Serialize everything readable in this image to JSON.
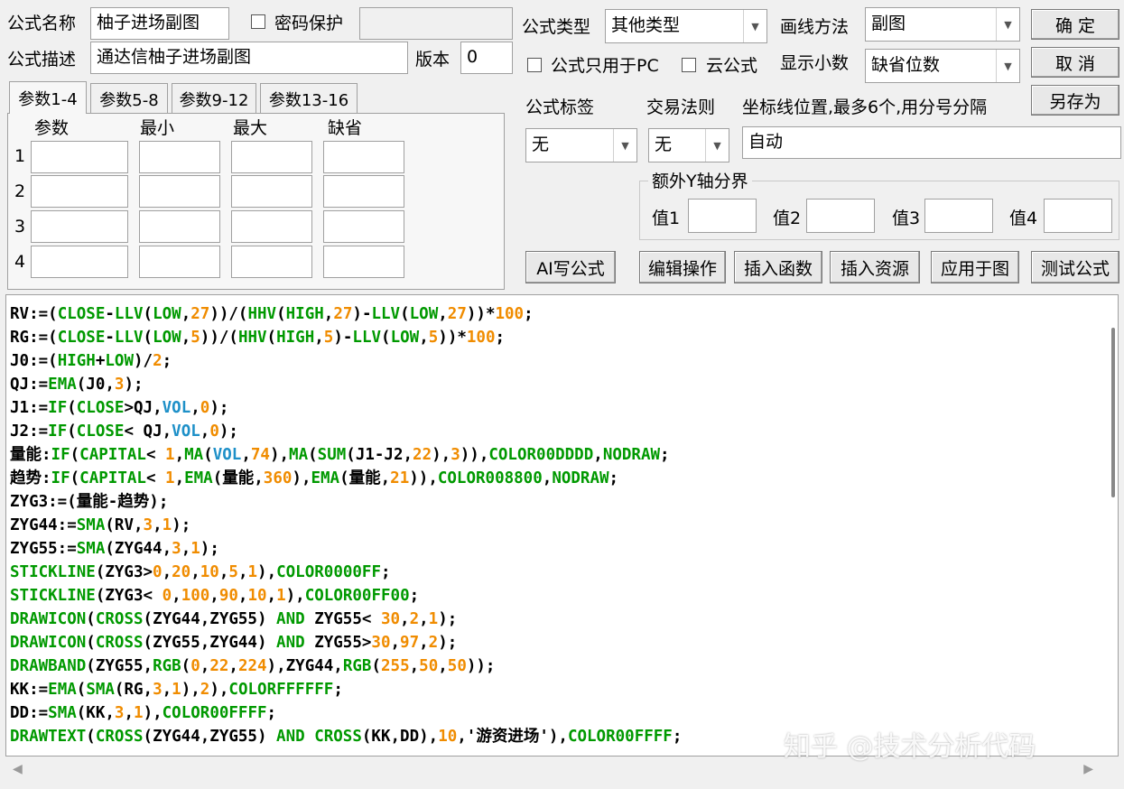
{
  "form": {
    "name_label": "公式名称",
    "name_value": "柚子进场副图",
    "password_label": "密码保护",
    "desc_label": "公式描述",
    "desc_value": "通达信柚子进场副图",
    "version_label": "版本",
    "version_value": "0",
    "type_label": "公式类型",
    "type_value": "其他类型",
    "draw_label": "画线方法",
    "draw_value": "副图",
    "pc_only_label": "公式只用于PC",
    "cloud_label": "云公式",
    "decimal_label": "显示小数",
    "decimal_value": "缺省位数",
    "tag_label": "公式标签",
    "tag_value": "无",
    "rule_label": "交易法则",
    "rule_value": "无",
    "axis_label": "坐标线位置,最多6个,用分号分隔",
    "axis_value": "自动",
    "extra_y_label": "额外Y轴分界",
    "v1": "值1",
    "v2": "值2",
    "v3": "值3",
    "v4": "值4"
  },
  "buttons": {
    "ok": "确  定",
    "cancel": "取  消",
    "save_as": "另存为",
    "ai": "AI写公式",
    "edit": "编辑操作",
    "insert_func": "插入函数",
    "insert_res": "插入资源",
    "apply": "应用于图",
    "test": "测试公式"
  },
  "tabs": [
    "参数1-4",
    "参数5-8",
    "参数9-12",
    "参数13-16"
  ],
  "params": {
    "headers": [
      "参数",
      "最小",
      "最大",
      "缺省"
    ],
    "rows": [
      "1",
      "2",
      "3",
      "4"
    ]
  },
  "code_lines": [
    [
      [
        "RV:=(",
        "b"
      ],
      [
        "CLOSE",
        "g"
      ],
      [
        "-",
        "b"
      ],
      [
        "LLV",
        "g"
      ],
      [
        "(",
        "b"
      ],
      [
        "LOW",
        "g"
      ],
      [
        ",",
        "b"
      ],
      [
        "27",
        "o"
      ],
      [
        "))/(",
        "b"
      ],
      [
        "HHV",
        "g"
      ],
      [
        "(",
        "b"
      ],
      [
        "HIGH",
        "g"
      ],
      [
        ",",
        "b"
      ],
      [
        "27",
        "o"
      ],
      [
        ")-",
        "b"
      ],
      [
        "LLV",
        "g"
      ],
      [
        "(",
        "b"
      ],
      [
        "LOW",
        "g"
      ],
      [
        ",",
        "b"
      ],
      [
        "27",
        "o"
      ],
      [
        "))*",
        "b"
      ],
      [
        "100",
        "o"
      ],
      [
        ";",
        "b"
      ]
    ],
    [
      [
        "RG:=(",
        "b"
      ],
      [
        "CLOSE",
        "g"
      ],
      [
        "-",
        "b"
      ],
      [
        "LLV",
        "g"
      ],
      [
        "(",
        "b"
      ],
      [
        "LOW",
        "g"
      ],
      [
        ",",
        "b"
      ],
      [
        "5",
        "o"
      ],
      [
        "))/(",
        "b"
      ],
      [
        "HHV",
        "g"
      ],
      [
        "(",
        "b"
      ],
      [
        "HIGH",
        "g"
      ],
      [
        ",",
        "b"
      ],
      [
        "5",
        "o"
      ],
      [
        ")-",
        "b"
      ],
      [
        "LLV",
        "g"
      ],
      [
        "(",
        "b"
      ],
      [
        "LOW",
        "g"
      ],
      [
        ",",
        "b"
      ],
      [
        "5",
        "o"
      ],
      [
        "))*",
        "b"
      ],
      [
        "100",
        "o"
      ],
      [
        ";",
        "b"
      ]
    ],
    [
      [
        "J0:=(",
        "b"
      ],
      [
        "HIGH",
        "g"
      ],
      [
        "+",
        "b"
      ],
      [
        "LOW",
        "g"
      ],
      [
        ")/",
        "b"
      ],
      [
        "2",
        "o"
      ],
      [
        ";",
        "b"
      ]
    ],
    [
      [
        "QJ:=",
        "b"
      ],
      [
        "EMA",
        "g"
      ],
      [
        "(J0,",
        "b"
      ],
      [
        "3",
        "o"
      ],
      [
        ");",
        "b"
      ]
    ],
    [
      [
        "J1:=",
        "b"
      ],
      [
        "IF",
        "g"
      ],
      [
        "(",
        "b"
      ],
      [
        "CLOSE",
        "g"
      ],
      [
        ">QJ,",
        "b"
      ],
      [
        "VOL",
        "u"
      ],
      [
        ",",
        "b"
      ],
      [
        "0",
        "o"
      ],
      [
        ");",
        "b"
      ]
    ],
    [
      [
        "J2:=",
        "b"
      ],
      [
        "IF",
        "g"
      ],
      [
        "(",
        "b"
      ],
      [
        "CLOSE",
        "g"
      ],
      [
        "< QJ,",
        "b"
      ],
      [
        "VOL",
        "u"
      ],
      [
        ",",
        "b"
      ],
      [
        "0",
        "o"
      ],
      [
        ");",
        "b"
      ]
    ],
    [
      [
        "量能:",
        "b"
      ],
      [
        "IF",
        "g"
      ],
      [
        "(",
        "b"
      ],
      [
        "CAPITAL",
        "g"
      ],
      [
        "< ",
        "b"
      ],
      [
        "1",
        "o"
      ],
      [
        ",",
        "b"
      ],
      [
        "MA",
        "g"
      ],
      [
        "(",
        "b"
      ],
      [
        "VOL",
        "u"
      ],
      [
        ",",
        "b"
      ],
      [
        "74",
        "o"
      ],
      [
        "),",
        "b"
      ],
      [
        "MA",
        "g"
      ],
      [
        "(",
        "b"
      ],
      [
        "SUM",
        "g"
      ],
      [
        "(J1-J2,",
        "b"
      ],
      [
        "22",
        "o"
      ],
      [
        "),",
        "b"
      ],
      [
        "3",
        "o"
      ],
      [
        ")),",
        "b"
      ],
      [
        "COLOR00DDDD",
        "g"
      ],
      [
        ",",
        "b"
      ],
      [
        "NODRAW",
        "g"
      ],
      [
        ";",
        "b"
      ]
    ],
    [
      [
        "趋势:",
        "b"
      ],
      [
        "IF",
        "g"
      ],
      [
        "(",
        "b"
      ],
      [
        "CAPITAL",
        "g"
      ],
      [
        "< ",
        "b"
      ],
      [
        "1",
        "o"
      ],
      [
        ",",
        "b"
      ],
      [
        "EMA",
        "g"
      ],
      [
        "(量能,",
        "b"
      ],
      [
        "360",
        "o"
      ],
      [
        "),",
        "b"
      ],
      [
        "EMA",
        "g"
      ],
      [
        "(量能,",
        "b"
      ],
      [
        "21",
        "o"
      ],
      [
        ")),",
        "b"
      ],
      [
        "COLOR008800",
        "g"
      ],
      [
        ",",
        "b"
      ],
      [
        "NODRAW",
        "g"
      ],
      [
        ";",
        "b"
      ]
    ],
    [
      [
        "ZYG3:=(量能-趋势);",
        "b"
      ]
    ],
    [
      [
        "ZYG44:=",
        "b"
      ],
      [
        "SMA",
        "g"
      ],
      [
        "(RV,",
        "b"
      ],
      [
        "3",
        "o"
      ],
      [
        ",",
        "b"
      ],
      [
        "1",
        "o"
      ],
      [
        ");",
        "b"
      ]
    ],
    [
      [
        "ZYG55:=",
        "b"
      ],
      [
        "SMA",
        "g"
      ],
      [
        "(ZYG44,",
        "b"
      ],
      [
        "3",
        "o"
      ],
      [
        ",",
        "b"
      ],
      [
        "1",
        "o"
      ],
      [
        ");",
        "b"
      ]
    ],
    [
      [
        "STICKLINE",
        "g"
      ],
      [
        "(ZYG3>",
        "b"
      ],
      [
        "0",
        "o"
      ],
      [
        ",",
        "b"
      ],
      [
        "20",
        "o"
      ],
      [
        ",",
        "b"
      ],
      [
        "10",
        "o"
      ],
      [
        ",",
        "b"
      ],
      [
        "5",
        "o"
      ],
      [
        ",",
        "b"
      ],
      [
        "1",
        "o"
      ],
      [
        "),",
        "b"
      ],
      [
        "COLOR0000FF",
        "g"
      ],
      [
        ";",
        "b"
      ]
    ],
    [
      [
        "STICKLINE",
        "g"
      ],
      [
        "(ZYG3< ",
        "b"
      ],
      [
        "0",
        "o"
      ],
      [
        ",",
        "b"
      ],
      [
        "100",
        "o"
      ],
      [
        ",",
        "b"
      ],
      [
        "90",
        "o"
      ],
      [
        ",",
        "b"
      ],
      [
        "10",
        "o"
      ],
      [
        ",",
        "b"
      ],
      [
        "1",
        "o"
      ],
      [
        "),",
        "b"
      ],
      [
        "COLOR00FF00",
        "g"
      ],
      [
        ";",
        "b"
      ]
    ],
    [
      [
        "DRAWICON",
        "g"
      ],
      [
        "(",
        "b"
      ],
      [
        "CROSS",
        "g"
      ],
      [
        "(ZYG44,ZYG55) ",
        "b"
      ],
      [
        "AND",
        "g"
      ],
      [
        " ZYG55< ",
        "b"
      ],
      [
        "30",
        "o"
      ],
      [
        ",",
        "b"
      ],
      [
        "2",
        "o"
      ],
      [
        ",",
        "b"
      ],
      [
        "1",
        "o"
      ],
      [
        ");",
        "b"
      ]
    ],
    [
      [
        "DRAWICON",
        "g"
      ],
      [
        "(",
        "b"
      ],
      [
        "CROSS",
        "g"
      ],
      [
        "(ZYG55,ZYG44) ",
        "b"
      ],
      [
        "AND",
        "g"
      ],
      [
        " ZYG55>",
        "b"
      ],
      [
        "30",
        "o"
      ],
      [
        ",",
        "b"
      ],
      [
        "97",
        "o"
      ],
      [
        ",",
        "b"
      ],
      [
        "2",
        "o"
      ],
      [
        ");",
        "b"
      ]
    ],
    [
      [
        "DRAWBAND",
        "g"
      ],
      [
        "(ZYG55,",
        "b"
      ],
      [
        "RGB",
        "g"
      ],
      [
        "(",
        "b"
      ],
      [
        "0",
        "o"
      ],
      [
        ",",
        "b"
      ],
      [
        "22",
        "o"
      ],
      [
        ",",
        "b"
      ],
      [
        "224",
        "o"
      ],
      [
        "),ZYG44,",
        "b"
      ],
      [
        "RGB",
        "g"
      ],
      [
        "(",
        "b"
      ],
      [
        "255",
        "o"
      ],
      [
        ",",
        "b"
      ],
      [
        "50",
        "o"
      ],
      [
        ",",
        "b"
      ],
      [
        "50",
        "o"
      ],
      [
        "));",
        "b"
      ]
    ],
    [
      [
        "KK:=",
        "b"
      ],
      [
        "EMA",
        "g"
      ],
      [
        "(",
        "b"
      ],
      [
        "SMA",
        "g"
      ],
      [
        "(RG,",
        "b"
      ],
      [
        "3",
        "o"
      ],
      [
        ",",
        "b"
      ],
      [
        "1",
        "o"
      ],
      [
        "),",
        "b"
      ],
      [
        "2",
        "o"
      ],
      [
        "),",
        "b"
      ],
      [
        "COLORFFFFFF",
        "g"
      ],
      [
        ";",
        "b"
      ]
    ],
    [
      [
        "DD:=",
        "b"
      ],
      [
        "SMA",
        "g"
      ],
      [
        "(KK,",
        "b"
      ],
      [
        "3",
        "o"
      ],
      [
        ",",
        "b"
      ],
      [
        "1",
        "o"
      ],
      [
        "),",
        "b"
      ],
      [
        "COLOR00FFFF",
        "g"
      ],
      [
        ";",
        "b"
      ]
    ],
    [
      [
        "DRAWTEXT",
        "g"
      ],
      [
        "(",
        "b"
      ],
      [
        "CROSS",
        "g"
      ],
      [
        "(ZYG44,ZYG55) ",
        "b"
      ],
      [
        "AND",
        "g"
      ],
      [
        " ",
        "b"
      ],
      [
        "CROSS",
        "g"
      ],
      [
        "(KK,DD),",
        "b"
      ],
      [
        "10",
        "o"
      ],
      [
        ",'游资进场'),",
        "b"
      ],
      [
        "COLOR00FFFF",
        "g"
      ],
      [
        ";",
        "b"
      ]
    ]
  ],
  "watermark": "知乎 @技术分析代码"
}
